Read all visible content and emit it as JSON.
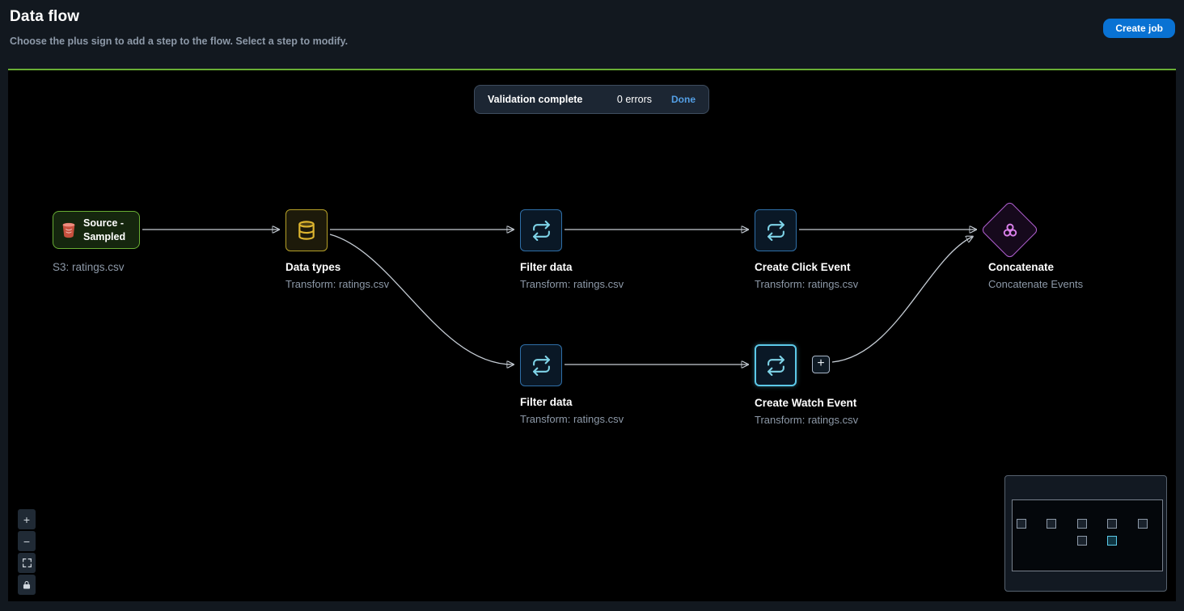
{
  "header": {
    "title": "Data flow",
    "subtitle": "Choose the plus sign to add a step to the flow. Select a step to modify.",
    "create_job_label": "Create job"
  },
  "toast": {
    "message": "Validation complete",
    "errors": "0 errors",
    "done_label": "Done"
  },
  "nodes": {
    "source": {
      "label": "Source - Sampled",
      "caption": "S3: ratings.csv"
    },
    "data_types": {
      "title": "Data types",
      "subtitle": "Transform: ratings.csv"
    },
    "filter_top": {
      "title": "Filter data",
      "subtitle": "Transform: ratings.csv"
    },
    "click_event": {
      "title": "Create Click Event",
      "subtitle": "Transform: ratings.csv"
    },
    "concatenate": {
      "title": "Concatenate",
      "subtitle": "Concatenate Events"
    },
    "filter_bottom": {
      "title": "Filter data",
      "subtitle": "Transform: ratings.csv"
    },
    "watch_event": {
      "title": "Create Watch Event",
      "subtitle": "Transform: ratings.csv"
    }
  },
  "add_step": {
    "plus_label": "+"
  },
  "controls": {
    "zoom_in": "+",
    "zoom_out": "−"
  },
  "icons": {
    "s3": "s3-bucket-icon",
    "data_types": "database-icon",
    "transform": "transform-cycle-icon",
    "concatenate": "concatenate-circles-icon",
    "fit": "fit-view-icon",
    "lock": "lock-icon"
  },
  "colors": {
    "accent_green": "#69ae34",
    "primary_blue": "#0972d3",
    "link_blue": "#539fe5",
    "selected_cyan": "#5cc9e8",
    "source_green": "#69ae34",
    "datatypes_yellow": "#ddb52f",
    "transform_blue": "#2f6fa8",
    "concat_magenta": "#b05fd0",
    "edge_gray": "#c5ccd4",
    "canvas_bg": "#000000"
  }
}
